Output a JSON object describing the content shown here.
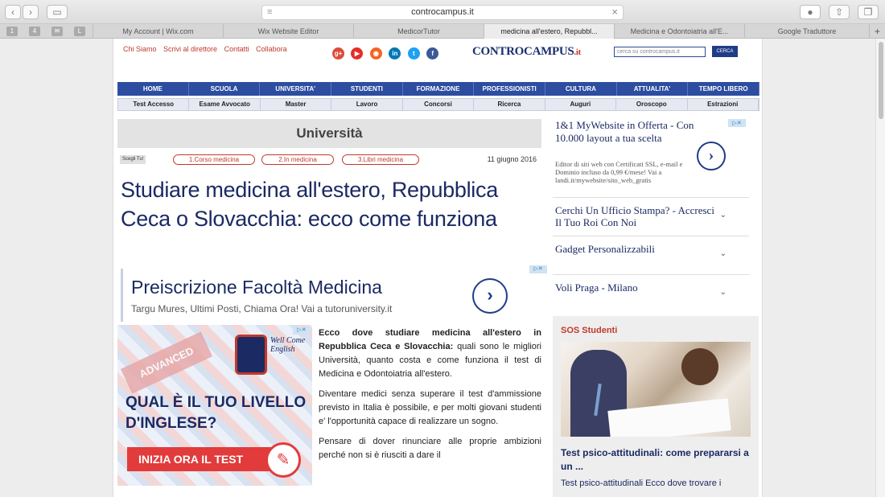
{
  "browser": {
    "url": "controcampus.it",
    "tabs": [
      "My Account | Wix.com",
      "Wix Website Editor",
      "MedicorTutor",
      "medicina all'estero, Repubbl...",
      "Medicina e Odontoiatria all'E...",
      "Google Traduttore"
    ],
    "new_tab": "+"
  },
  "top_links": [
    "Chi Siamo",
    "Scrivi al direttore",
    "Contatti",
    "Collabora"
  ],
  "logo": {
    "main": "CONTROCAMPUS",
    "suffix": ".it"
  },
  "search": {
    "placeholder": "cerca su controcampus.it",
    "button": "CERCA"
  },
  "nav_primary": [
    "HOME",
    "SCUOLA",
    "UNIVERSITA'",
    "STUDENTI",
    "FORMAZIONE",
    "PROFESSIONISTI",
    "CULTURA",
    "ATTUALITA'",
    "TEMPO LIBERO"
  ],
  "nav_secondary": [
    "Test Accesso",
    "Esame Avvocato",
    "Master",
    "Lavoro",
    "Concorsi",
    "Ricerca",
    "Auguri",
    "Oroscopo",
    "Estrazioni"
  ],
  "section_title": "Università",
  "share_label": "Scegli Tu!",
  "chips": [
    "1.Corso medicina",
    "2.In medicina",
    "3.Libri medicina"
  ],
  "date": "11 giugno 2016",
  "headline": "Studiare medicina all'estero, Repubblica Ceca o Slovacchia: ecco come funziona",
  "ad_top": {
    "title": "Preiscrizione Facoltà Medicina",
    "subtitle": "Targu Mures, Ultimi Posti, Chiama Ora!",
    "link": "Vai a tutoruniversity.it"
  },
  "ad_english": {
    "badge": "ADVANCED",
    "brand": "Well Come English",
    "question": "QUAL È IL TUO LIVELLO D'INGLESE?",
    "cta": "INIZIA ORA IL TEST"
  },
  "article": {
    "lead_bold": "Ecco dove studiare medicina all'estero in Repubblica Ceca e Slovacchia:",
    "lead_rest": " quali sono le migliori Università, quanto costa e come funziona il test di Medicina e Odontoiatria all'estero.",
    "p2": "Diventare medici senza superare il test d'ammissione previsto in Italia è possibile, e per moltі giovani studenti e' l'opportunità capace di realizzare un sogno.",
    "p3": "Pensare di dover rinunciare alle proprie ambizioni perché non si è riusciti a dare il"
  },
  "sidebar": {
    "ad": {
      "title": "1&1 MyWebsite in Offerta - Con 10.000 layout a tua scelta",
      "text": "Editor di siti web con Certificati SSL, e-mail e Dominio incluso da 0,99 €/mese! Vai a landi.it/mywebsite/sito_web_gratis"
    },
    "links": [
      "Cerchi Un Ufficio Stampa? - Accresci Il Tuo Roi Con Noi",
      "Gadget Personalizzabili",
      "Voli Praga - Milano"
    ],
    "sos": {
      "heading": "SOS Studenti",
      "title": "Test psico-attitudinali: come prepararsi a un ...",
      "excerpt": "Test psico-attitudinali Ecco dove trovare i"
    }
  },
  "colors": {
    "brand_blue": "#2c4da0",
    "brand_red": "#c0392b",
    "headline": "#1b2a63"
  },
  "icons": [
    "google-plus-icon",
    "youtube-icon",
    "rss-icon",
    "linkedin-icon",
    "twitter-icon",
    "facebook-icon"
  ]
}
